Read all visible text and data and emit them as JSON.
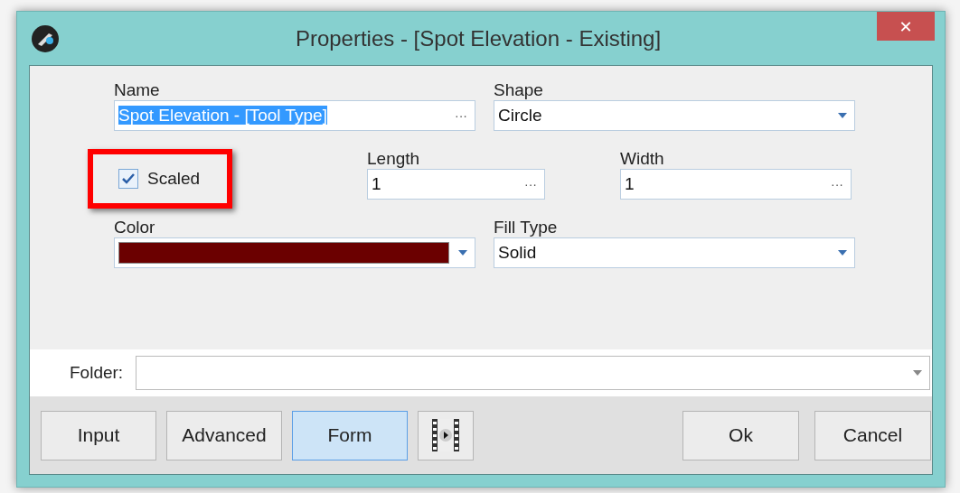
{
  "window": {
    "title": "Properties - [Spot Elevation - Existing]",
    "close": "✕"
  },
  "rows": [
    [
      {
        "kind": "text",
        "label": "Name",
        "value": "Spot Elevation - [Tool Type]",
        "selected": true,
        "button": "···"
      },
      {
        "kind": "dropdown",
        "label": "Shape",
        "value": "Circle"
      }
    ],
    [
      {
        "kind": "checkbox",
        "label": "Scaled",
        "checked": true,
        "highlighted": true
      },
      {
        "kind": "text",
        "label": "Length",
        "value": "1",
        "selected": false,
        "button": "···"
      },
      {
        "kind": "text",
        "label": "Width",
        "value": "1",
        "selected": false,
        "button": "···"
      }
    ],
    [
      {
        "kind": "color",
        "label": "Color",
        "color": "#6b0000"
      },
      {
        "kind": "dropdown",
        "label": "Fill Type",
        "value": "Solid"
      }
    ]
  ],
  "folder": {
    "label": "Folder:"
  },
  "buttons_left": [
    {
      "label": "Input",
      "selected": false
    },
    {
      "label": "Advanced",
      "selected": false
    },
    {
      "label": "Form",
      "selected": true
    },
    {
      "kind": "icon",
      "selected": false
    }
  ],
  "buttons_right": [
    {
      "label": "Ok"
    },
    {
      "label": "Cancel"
    }
  ]
}
